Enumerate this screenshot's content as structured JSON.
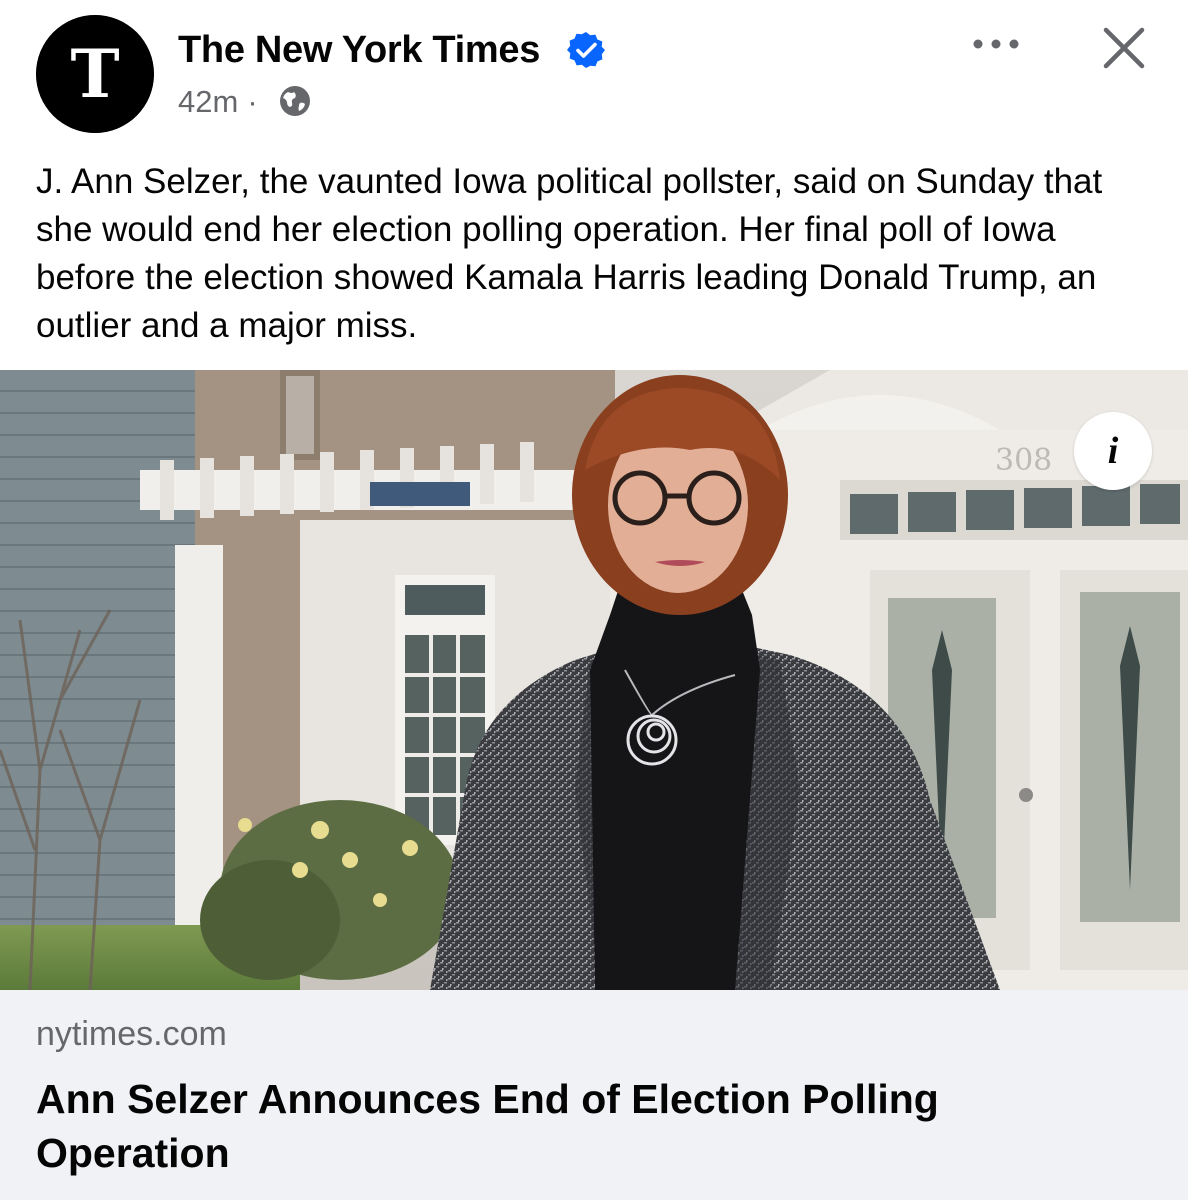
{
  "post": {
    "page_name": "The New York Times",
    "timestamp": "42m",
    "separator": "·",
    "audience_icon": "globe-icon",
    "verified_icon": "verified-badge-icon",
    "more_icon": "more-options-icon",
    "close_icon": "close-icon",
    "text": "J. Ann Selzer, the vaunted Iowa political pollster, said on Sunday that she would end her election polling operation. Her final poll of Iowa before the election showed Kamala Harris leading Donald Trump, an outlier and a major miss.",
    "avatar_letter": "T",
    "image_house_number": "308"
  },
  "link": {
    "domain": "nytimes.com",
    "title": "Ann Selzer Announces End of Election Polling Operation",
    "info_label": "i"
  },
  "colors": {
    "verified": "#0866ff",
    "secondary_text": "#65676b",
    "card_bg": "#f0f2f5",
    "primary_text": "#050505"
  }
}
